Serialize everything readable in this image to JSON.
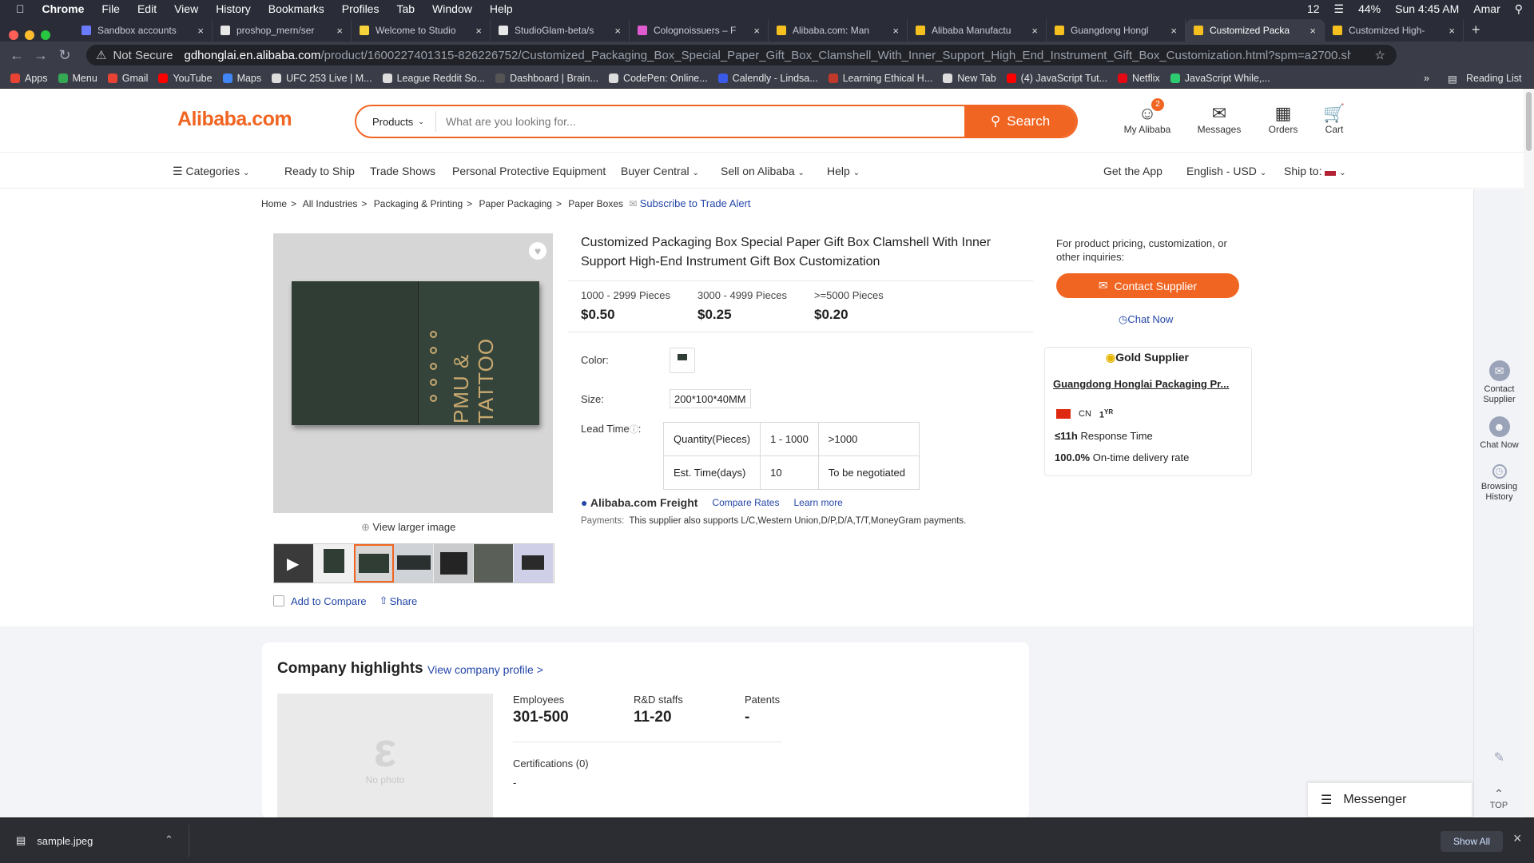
{
  "menubar": {
    "app": "Chrome",
    "items": [
      "File",
      "Edit",
      "View",
      "History",
      "Bookmarks",
      "Profiles",
      "Tab",
      "Window",
      "Help"
    ],
    "battery": "44%",
    "clock": "Sun 4:45 AM",
    "user": "Amar",
    "wifi_count": "12"
  },
  "tabs": [
    "Sandbox accounts",
    "proshop_mern/ser",
    "Welcome to Studio",
    "StudioGlam-beta/s",
    "Colognoissuers – F",
    "Alibaba.com: Man",
    "Alibaba Manufactu",
    "Guangdong Hongl",
    "Customized Packa",
    "Customized High-"
  ],
  "active_tab": 8,
  "address": {
    "security": "Not Secure",
    "host": "gdhonglai.en.alibaba.com",
    "path": "/product/1600227401315-826226752/Customized_Packaging_Box_Special_Paper_Gift_Box_Clamshell_With_Inner_Support_High_End_Instrument_Gift_Box_Customization.html?spm=a2700.shop_ot..."
  },
  "bookmarks": [
    {
      "label": "Apps",
      "color": "#e94335"
    },
    {
      "label": "Menu",
      "color": "#34a853"
    },
    {
      "label": "Gmail",
      "color": "#ea4335"
    },
    {
      "label": "YouTube",
      "color": "#ff0000"
    },
    {
      "label": "Maps",
      "color": "#4285f4"
    },
    {
      "label": "UFC 253 Live | M...",
      "color": "#dddddd"
    },
    {
      "label": "League Reddit So...",
      "color": "#dddddd"
    },
    {
      "label": "Dashboard | Brain...",
      "color": "#555555"
    },
    {
      "label": "CodePen: Online...",
      "color": "#dddddd"
    },
    {
      "label": "Calendly - Lindsa...",
      "color": "#3a5ae8"
    },
    {
      "label": "Learning Ethical H...",
      "color": "#c0392b"
    },
    {
      "label": "New Tab",
      "color": "#dddddd"
    },
    {
      "label": "(4) JavaScript Tut...",
      "color": "#ff0000"
    },
    {
      "label": "Netflix",
      "color": "#e50914"
    },
    {
      "label": "JavaScript While,...",
      "color": "#2ecc71"
    }
  ],
  "bookmarks_more": "»",
  "reading_list": "Reading List",
  "header": {
    "logo": "Alibaba.com",
    "search_category": "Products",
    "search_placeholder": "What are you looking for...",
    "search_button": "Search",
    "my_alibaba": "My Alibaba",
    "my_alibaba_badge": "2",
    "messages": "Messages",
    "orders": "Orders",
    "cart": "Cart"
  },
  "nav": {
    "categories": "Categories",
    "items": [
      "Ready to Ship",
      "Trade Shows",
      "Personal Protective Equipment",
      "Buyer Central",
      "Sell on Alibaba",
      "Help"
    ],
    "get_app": "Get the App",
    "language": "English - USD",
    "ship_to": "Ship to:"
  },
  "breadcrumb": [
    "Home",
    "All Industries",
    "Packaging & Printing",
    "Paper Packaging",
    "Paper Boxes"
  ],
  "trade_alert": "Subscribe to Trade Alert",
  "gallery": {
    "view_larger": "View larger image",
    "add_compare": "Add to Compare",
    "share": "Share",
    "box_text": "PMU & TATTOO"
  },
  "product": {
    "title": "Customized Packaging Box Special Paper Gift Box Clamshell With Inner Support High-End Instrument Gift Box Customization",
    "tiers": [
      {
        "qty": "1000 - 2999 Pieces",
        "price": "$0.50"
      },
      {
        "qty": "3000 - 4999 Pieces",
        "price": "$0.25"
      },
      {
        "qty": ">=5000 Pieces",
        "price": "$0.20"
      }
    ],
    "color_label": "Color:",
    "size_label": "Size:",
    "size_value": "200*100*40MM",
    "lead_label": "Lead Time",
    "lead_table": [
      [
        "Quantity(Pieces)",
        "1 - 1000",
        ">1000"
      ],
      [
        "Est. Time(days)",
        "10",
        "To be negotiated"
      ]
    ],
    "freight": "Alibaba.com Freight",
    "compare_rates": "Compare Rates",
    "learn_more": "Learn more",
    "payments_label": "Payments:",
    "payments": "This supplier also supports L/C,Western Union,D/P,D/A,T/T,MoneyGram payments."
  },
  "supplier": {
    "inquiry": "For product pricing, customization, or other inquiries:",
    "contact_button": "Contact Supplier",
    "chat_now": "Chat Now",
    "gold": "Gold Supplier",
    "name": "Guangdong Honglai Packaging Pr...",
    "country": "CN",
    "years": "1",
    "years_unit": "YR",
    "response_time": "≤11h",
    "response_label": "Response Time",
    "delivery_rate": "100.0%",
    "delivery_label": "On-time delivery rate"
  },
  "side": {
    "contact": "Contact Supplier",
    "chat": "Chat Now",
    "history": "Browsing History",
    "top": "TOP"
  },
  "company": {
    "title": "Company highlights",
    "view_profile": "View company profile >",
    "no_photo": "No photo",
    "stats": [
      {
        "label": "Employees",
        "value": "301-500"
      },
      {
        "label": "R&D staffs",
        "value": "11-20"
      },
      {
        "label": "Patents",
        "value": "-"
      }
    ],
    "certs_label": "Certifications (0)",
    "certs_value": "-"
  },
  "messenger": "Messenger",
  "download": {
    "file": "sample.jpeg",
    "show_all": "Show All"
  }
}
